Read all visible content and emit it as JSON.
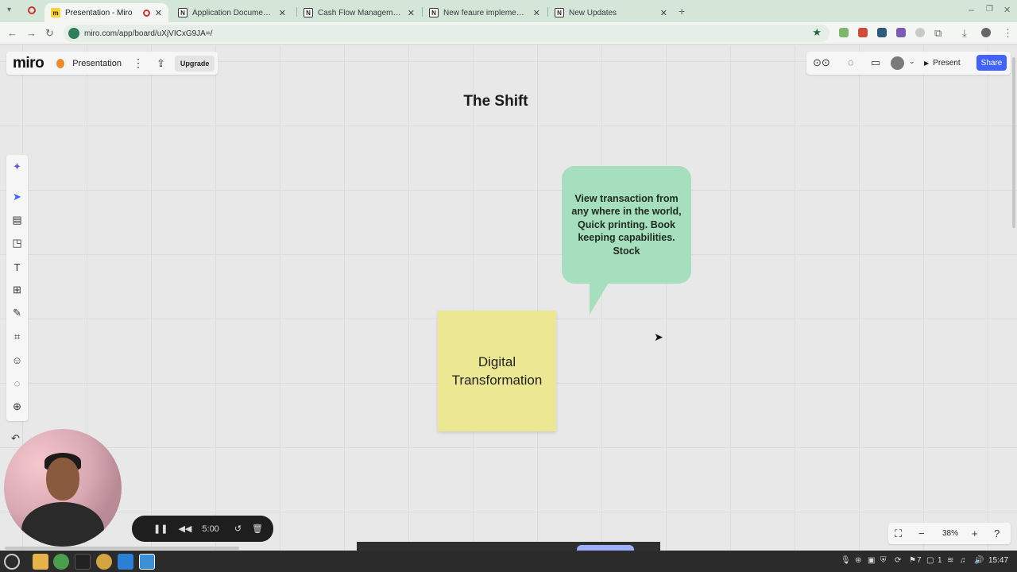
{
  "browser": {
    "tabs": [
      {
        "title": "Presentation - Miro",
        "active": true
      },
      {
        "title": "Application Documentation",
        "active": false
      },
      {
        "title": "Cash Flow Management Sys",
        "active": false
      },
      {
        "title": "New feaure implementation",
        "active": false
      },
      {
        "title": "New Updates",
        "active": false
      }
    ],
    "url": "miro.com/app/board/uXjVICxG9JA=/"
  },
  "miro": {
    "logo": "miro",
    "board_name": "Presentation",
    "upgrade_label": "Upgrade",
    "present_label": "Present",
    "share_label": "Share",
    "zoom_level": "38%"
  },
  "canvas": {
    "title": "The Shift",
    "bubble_text": "View transaction from any where in the world, Quick printing. Book keeping capabilities. Stock",
    "sticky_text": "Digital Transformation"
  },
  "recorder": {
    "timer": "5:00"
  },
  "taskbar": {
    "tray_count": "7",
    "tray_count2": "1",
    "time": "15:47"
  },
  "colors": {
    "accent": "#4262ff",
    "bubble": "#a6dfbe",
    "sticky": "#ebe792",
    "tab_strip": "#d3e6d8"
  }
}
